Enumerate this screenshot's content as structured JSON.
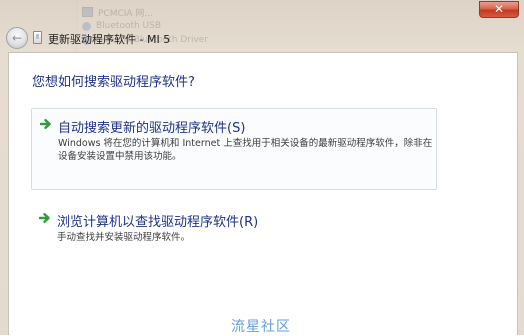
{
  "window": {
    "title": "更新驱动程序软件 - MI 5",
    "close_glyph": "✕",
    "back_glyph": "←"
  },
  "background_list": [
    "PCMCIA 网...",
    "Bluetooth USB",
    "Generic Bluetooth Driver"
  ],
  "main": {
    "heading": "您想如何搜索驱动程序软件?",
    "options": [
      {
        "title": "自动搜索更新的驱动程序软件(S)",
        "description": "Windows 将在您的计算机和 Internet 上查找用于相关设备的最新驱动程序软件，除非在设备安装设置中禁用该功能。",
        "icon": "green-arrow-icon"
      },
      {
        "title": "浏览计算机以查找驱动程序软件(R)",
        "description": "手动查找并安装驱动程序软件。",
        "icon": "green-arrow-icon"
      }
    ]
  },
  "watermark": "流星社区",
  "colors": {
    "accent_text": "#1e3287",
    "arrow_green": "#2f9b3a",
    "close_red": "#c2391f",
    "frame": "#e4dbcf"
  }
}
